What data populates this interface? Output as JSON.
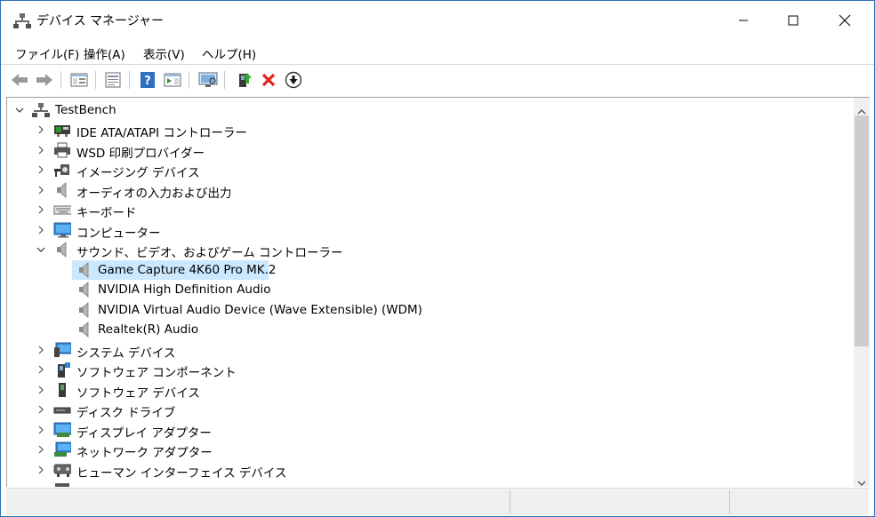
{
  "window": {
    "title": "デバイス マネージャー",
    "icon": "device-manager-icon"
  },
  "menu": [
    {
      "label": "ファイル(F)"
    },
    {
      "label": "操作(A)"
    },
    {
      "label": "表示(V)"
    },
    {
      "label": "ヘルプ(H)"
    }
  ],
  "toolbar": {
    "icons": [
      "back-arrow-icon",
      "forward-arrow-icon",
      "show-hide-tree-icon",
      "properties-icon",
      "help-icon",
      "action-pane-icon",
      "scan-hardware-icon",
      "update-driver-icon",
      "uninstall-icon",
      "disable-device-icon"
    ]
  },
  "tree": {
    "root": "TestBench",
    "categories": [
      {
        "label": "IDE ATA/ATAPI コントローラー",
        "icon": "ide-controller-icon",
        "expanded": false
      },
      {
        "label": "WSD 印刷プロバイダー",
        "icon": "printer-icon",
        "expanded": false
      },
      {
        "label": "イメージング デバイス",
        "icon": "camera-icon",
        "expanded": false
      },
      {
        "label": "オーディオの入力および出力",
        "icon": "speaker-icon",
        "expanded": false
      },
      {
        "label": "キーボード",
        "icon": "keyboard-icon",
        "expanded": false
      },
      {
        "label": "コンピューター",
        "icon": "computer-icon",
        "expanded": false
      },
      {
        "label": "サウンド、ビデオ、およびゲーム コントローラー",
        "icon": "speaker-icon",
        "expanded": true,
        "children": [
          {
            "label": "Game Capture 4K60 Pro MK.2",
            "selected": true
          },
          {
            "label": "NVIDIA High Definition Audio"
          },
          {
            "label": "NVIDIA Virtual Audio Device (Wave Extensible) (WDM)"
          },
          {
            "label": "Realtek(R) Audio"
          }
        ]
      },
      {
        "label": "システム デバイス",
        "icon": "system-device-icon",
        "expanded": false
      },
      {
        "label": "ソフトウェア コンポーネント",
        "icon": "software-component-icon",
        "expanded": false
      },
      {
        "label": "ソフトウェア デバイス",
        "icon": "software-device-icon",
        "expanded": false
      },
      {
        "label": "ディスク ドライブ",
        "icon": "disk-drive-icon",
        "expanded": false
      },
      {
        "label": "ディスプレイ アダプター",
        "icon": "display-adapter-icon",
        "expanded": false
      },
      {
        "label": "ネットワーク アダプター",
        "icon": "network-adapter-icon",
        "expanded": false
      },
      {
        "label": "ヒューマン インターフェイス デバイス",
        "icon": "hid-icon",
        "expanded": false
      }
    ]
  }
}
